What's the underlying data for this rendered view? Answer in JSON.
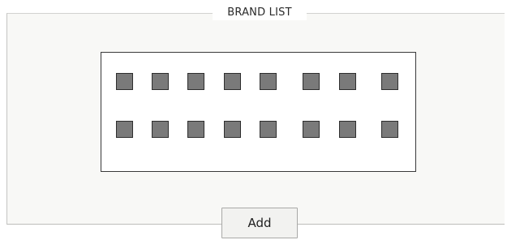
{
  "brand_list": {
    "title": "BRAND LIST",
    "tile_rows": [
      [
        {
          "icon": "brand-logo-placeholder"
        },
        {
          "icon": "brand-logo-placeholder"
        },
        {
          "icon": "brand-logo-placeholder"
        },
        {
          "icon": "brand-logo-placeholder"
        },
        {
          "icon": "brand-logo-placeholder"
        },
        {
          "icon": "brand-logo-placeholder"
        },
        {
          "icon": "brand-logo-placeholder"
        },
        {
          "icon": "brand-logo-placeholder"
        }
      ],
      [
        {
          "icon": "brand-logo-placeholder"
        },
        {
          "icon": "brand-logo-placeholder"
        },
        {
          "icon": "brand-logo-placeholder"
        },
        {
          "icon": "brand-logo-placeholder"
        },
        {
          "icon": "brand-logo-placeholder"
        },
        {
          "icon": "brand-logo-placeholder"
        },
        {
          "icon": "brand-logo-placeholder"
        },
        {
          "icon": "brand-logo-placeholder"
        }
      ]
    ],
    "add_label": "Add"
  },
  "colors": {
    "tile_fill": "#7a7a7a",
    "tile_border": "#2e2e2e",
    "panel_bg": "#f8f8f6"
  }
}
